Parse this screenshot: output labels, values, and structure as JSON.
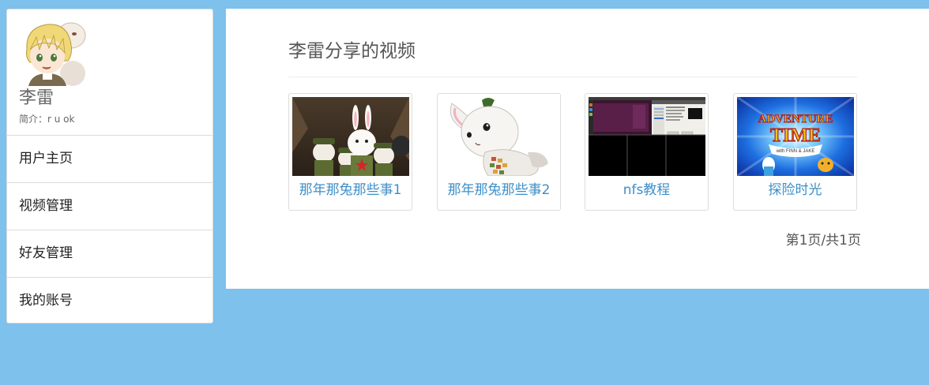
{
  "user": {
    "name": "李雷",
    "bio_label": "简介：",
    "bio_value": "r u ok",
    "avatar_icon": "anime-avatar-icon"
  },
  "nav": {
    "items": [
      {
        "label": "用户主页"
      },
      {
        "label": "视频管理"
      },
      {
        "label": "好友管理"
      },
      {
        "label": "我的账号"
      }
    ]
  },
  "main": {
    "title": "李雷分享的视频",
    "videos": [
      {
        "title": "那年那兔那些事1",
        "thumb_icon": "rabbit-soldiers-thumbnail"
      },
      {
        "title": "那年那兔那些事2",
        "thumb_icon": "white-rabbit-thumbnail"
      },
      {
        "title": "nfs教程",
        "thumb_icon": "desktop-screenshot-thumbnail"
      },
      {
        "title": "探险时光",
        "thumb_icon": "adventure-time-thumbnail",
        "thumb_text_1": "ADVENTURE",
        "thumb_text_2": "TIME",
        "thumb_text_3": "with FINN & JAKE"
      }
    ],
    "pagination": "第1页/共1页"
  },
  "colors": {
    "background": "#7dc1ec",
    "link": "#3d8fc9",
    "panel": "#ffffff"
  }
}
